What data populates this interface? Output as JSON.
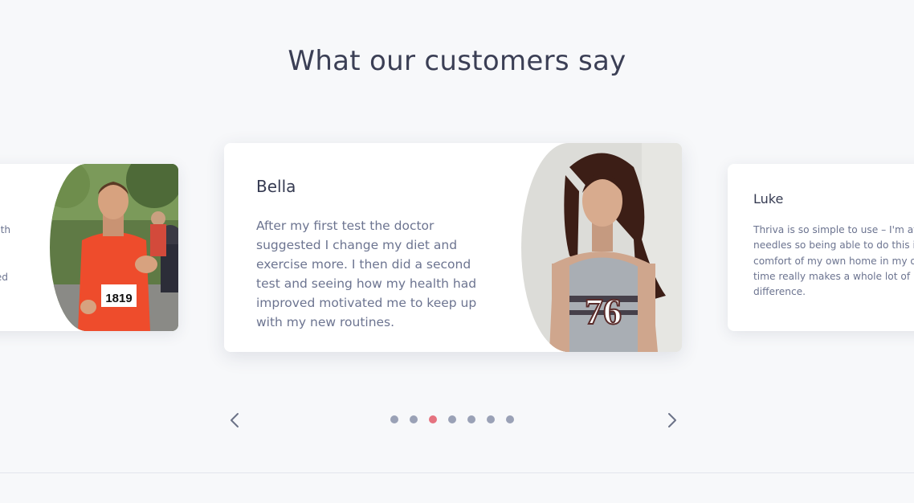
{
  "section": {
    "title": "What our customers say"
  },
  "testimonials": {
    "left": {
      "fragment_1": "vith",
      "fragment_2": "red",
      "photo": "runner-photo"
    },
    "center": {
      "name": "Bella",
      "quote": "After my first test the doctor suggested I change my diet and exercise more. I then did a second test and seeing how my health had improved motivated me to keep up with my new routines.",
      "photo": "bella-photo"
    },
    "right": {
      "name": "Luke",
      "quote": "Thriva is so simple to use – I'm afra\nneedles so being able to do this in\ncomfort of my own home in my ow\ntime really makes a whole lot of\ndifference."
    }
  },
  "runner_bib": "1819",
  "bella_shirt": "76",
  "carousel": {
    "prev_icon": "chevron-left-icon",
    "next_icon": "chevron-right-icon",
    "dot_count": 7,
    "active_index": 2,
    "colors": {
      "dot": "#9aa1b6",
      "dot_active": "#e5727f"
    }
  }
}
